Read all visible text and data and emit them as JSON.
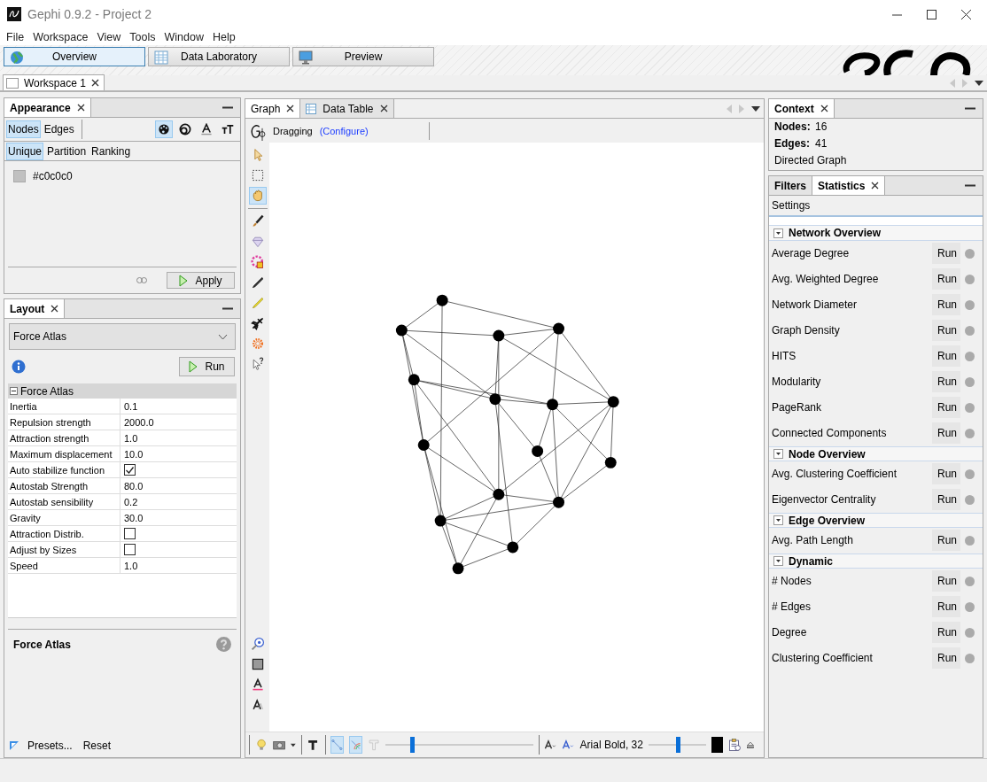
{
  "window": {
    "title": "Gephi 0.9.2 - Project 2"
  },
  "menu": [
    "File",
    "Workspace",
    "View",
    "Tools",
    "Window",
    "Help"
  ],
  "perspectives": [
    {
      "label": "Overview",
      "kind": "globe",
      "selected": true
    },
    {
      "label": "Data Laboratory",
      "kind": "table",
      "selected": false
    },
    {
      "label": "Preview",
      "kind": "monitor",
      "selected": false
    }
  ],
  "workspace_tabs": [
    {
      "label": "Workspace 1",
      "selected": true
    }
  ],
  "appearance": {
    "title": "Appearance",
    "element_tabs": [
      {
        "label": "Nodes",
        "selected": true
      },
      {
        "label": "Edges",
        "selected": false
      }
    ],
    "transforms": [
      {
        "kind": "color",
        "selected": true
      },
      {
        "kind": "size",
        "selected": false
      },
      {
        "kind": "label-color",
        "selected": false
      },
      {
        "kind": "label-size",
        "selected": false
      }
    ],
    "mode_tabs": [
      {
        "label": "Unique",
        "selected": true
      },
      {
        "label": "Partition",
        "selected": false
      },
      {
        "label": "Ranking",
        "selected": false
      }
    ],
    "swatch": {
      "color": "#c0c0c0",
      "value": "#c0c0c0"
    },
    "apply": "Apply"
  },
  "layout": {
    "title": "Layout",
    "algorithm": "Force Atlas",
    "run": "Run",
    "group": "Force Atlas",
    "expanded": true,
    "properties": [
      {
        "name": "Inertia",
        "kind": "text",
        "value": "0.1"
      },
      {
        "name": "Repulsion strength",
        "kind": "text",
        "value": "2000.0"
      },
      {
        "name": "Attraction strength",
        "kind": "text",
        "value": "1.0"
      },
      {
        "name": "Maximum displacement",
        "kind": "text",
        "value": "10.0"
      },
      {
        "name": "Auto stabilize function",
        "kind": "checkbox",
        "checked": true
      },
      {
        "name": "Autostab Strength",
        "kind": "text",
        "value": "80.0"
      },
      {
        "name": "Autostab sensibility",
        "kind": "text",
        "value": "0.2"
      },
      {
        "name": "Gravity",
        "kind": "text",
        "value": "30.0"
      },
      {
        "name": "Attraction Distrib.",
        "kind": "checkbox",
        "checked": false
      },
      {
        "name": "Adjust by Sizes",
        "kind": "checkbox",
        "checked": false
      },
      {
        "name": "Speed",
        "kind": "text",
        "value": "1.0"
      }
    ],
    "description_title": "Force Atlas",
    "presets": "Presets...",
    "reset": "Reset"
  },
  "graph": {
    "tabs": [
      {
        "label": "Graph",
        "kind": "graph",
        "selected": true
      },
      {
        "label": "Data Table",
        "kind": "table",
        "selected": false
      }
    ],
    "mode": "Dragging",
    "configure": "(Configure)",
    "tools": [
      {
        "kind": "pointer",
        "selected": false
      },
      {
        "kind": "rect-select",
        "selected": false
      },
      {
        "kind": "hand",
        "selected": true
      },
      {
        "kind": "brush",
        "selected": false
      },
      {
        "kind": "diamond",
        "selected": false
      },
      {
        "kind": "palette",
        "selected": false
      },
      {
        "kind": "pencil",
        "selected": false
      },
      {
        "kind": "highlighter",
        "selected": false
      },
      {
        "kind": "airplane",
        "selected": false
      },
      {
        "kind": "gear",
        "selected": false
      },
      {
        "kind": "help-pointer",
        "selected": false
      }
    ],
    "bottom_tools": [
      {
        "kind": "zoom-fit"
      },
      {
        "kind": "square"
      },
      {
        "kind": "text-color"
      },
      {
        "kind": "text-size"
      }
    ],
    "toggles": [
      {
        "kind": "node-labels",
        "selected": false
      },
      {
        "kind": "edges",
        "selected": true
      },
      {
        "kind": "edge-color",
        "selected": true
      },
      {
        "kind": "edge-labels",
        "selected": false
      }
    ],
    "edge_scale": {
      "level": 0.18
    },
    "font": "Arial Bold, 32",
    "label_size": {
      "level": 0.5
    }
  },
  "context": {
    "title": "Context",
    "nodes_label": "Nodes:",
    "nodes": "16",
    "edges_label": "Edges:",
    "edges": "41",
    "graph_type": "Directed Graph"
  },
  "statistics": {
    "tabs": [
      {
        "label": "Filters",
        "selected": false
      },
      {
        "label": "Statistics",
        "selected": true
      }
    ],
    "settings": "Settings",
    "groups": [
      {
        "title": "Network Overview",
        "expanded": true,
        "items": [
          {
            "name": "Average Degree",
            "run": "Run"
          },
          {
            "name": "Avg. Weighted Degree",
            "run": "Run"
          },
          {
            "name": "Network Diameter",
            "run": "Run"
          },
          {
            "name": "Graph Density",
            "run": "Run"
          },
          {
            "name": "HITS",
            "run": "Run"
          },
          {
            "name": "Modularity",
            "run": "Run"
          },
          {
            "name": "PageRank",
            "run": "Run"
          },
          {
            "name": "Connected Components",
            "run": "Run"
          }
        ]
      },
      {
        "title": "Node Overview",
        "expanded": true,
        "items": [
          {
            "name": "Avg. Clustering Coefficient",
            "run": "Run"
          },
          {
            "name": "Eigenvector Centrality",
            "run": "Run"
          }
        ]
      },
      {
        "title": "Edge Overview",
        "expanded": true,
        "items": [
          {
            "name": "Avg. Path Length",
            "run": "Run"
          }
        ]
      },
      {
        "title": "Dynamic",
        "expanded": true,
        "items": [
          {
            "name": "# Nodes",
            "run": "Run"
          },
          {
            "name": "# Edges",
            "run": "Run"
          },
          {
            "name": "Degree",
            "run": "Run"
          },
          {
            "name": "Clustering Coefficient",
            "run": "Run"
          }
        ]
      }
    ]
  }
}
